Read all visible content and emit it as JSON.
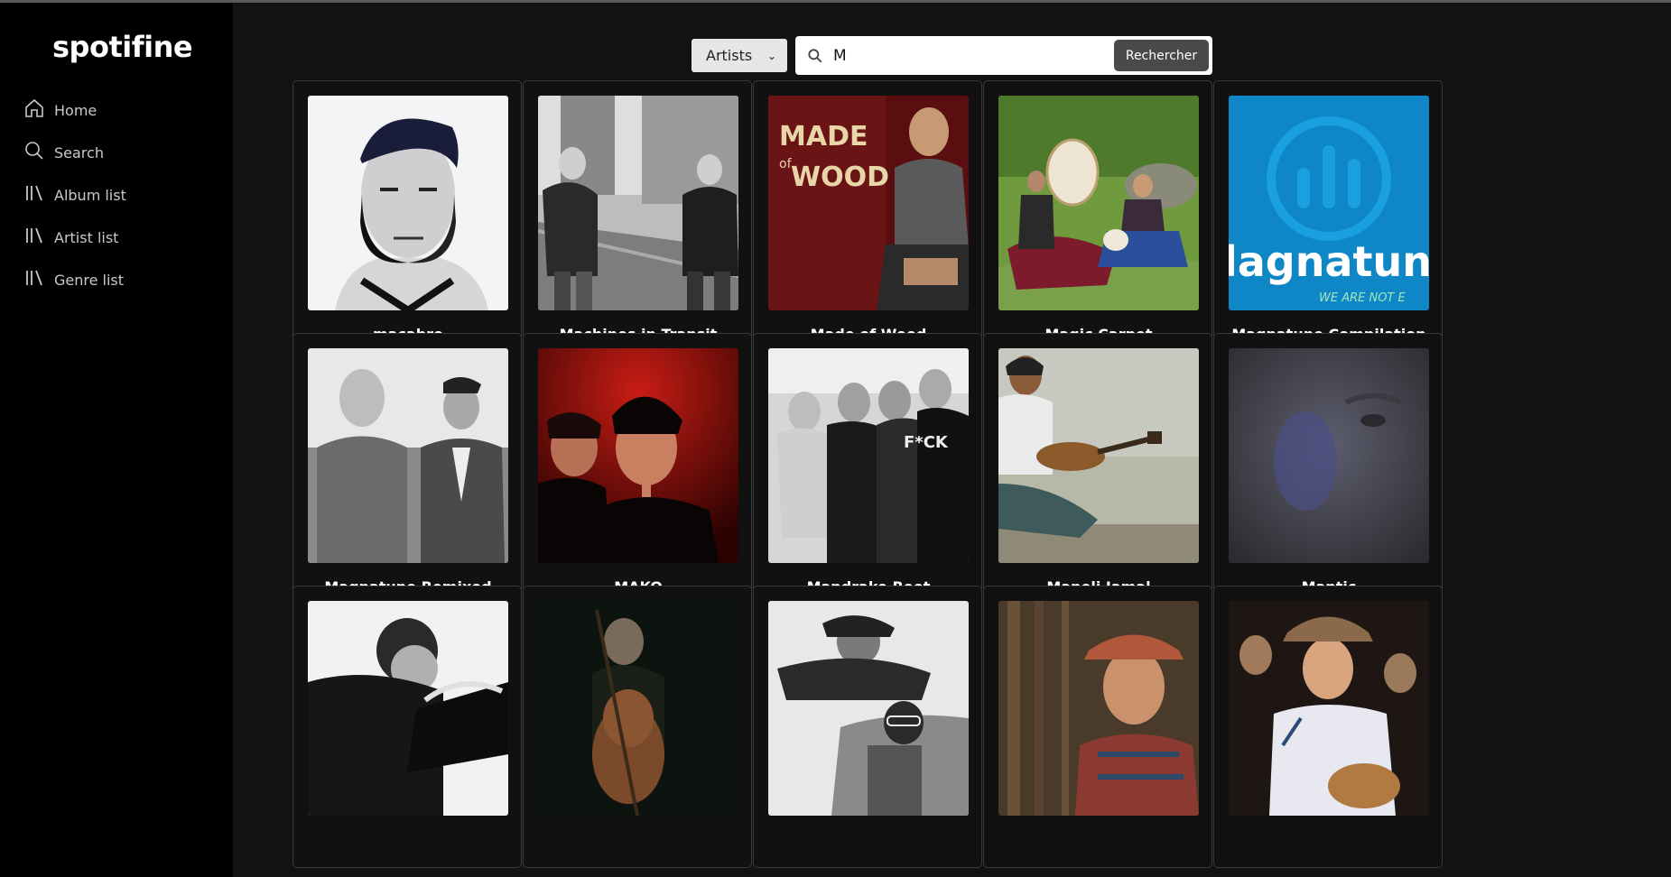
{
  "app": {
    "logo": "spotifine"
  },
  "sidebar": {
    "items": [
      {
        "label": "Home",
        "icon": "home-icon"
      },
      {
        "label": "Search",
        "icon": "search-icon"
      },
      {
        "label": "Album list",
        "icon": "library-icon"
      },
      {
        "label": "Artist list",
        "icon": "library-icon"
      },
      {
        "label": "Genre list",
        "icon": "library-icon"
      }
    ]
  },
  "search": {
    "category": "Artists",
    "query": "M",
    "button_label": "Rechercher"
  },
  "artists": [
    {
      "name": "macabro"
    },
    {
      "name": "Machines in Transit"
    },
    {
      "name": "Made of Wood"
    },
    {
      "name": "Magic Carpet"
    },
    {
      "name": "Magnatune Compilation",
      "art_text": "lagnatune",
      "art_sub": "WE ARE NOT E"
    },
    {
      "name": "Magnatune Remixed"
    },
    {
      "name": "MAKO"
    },
    {
      "name": "Mandrake Root"
    },
    {
      "name": "Maneli Jamal"
    },
    {
      "name": "Mantic"
    },
    {
      "name": ""
    },
    {
      "name": ""
    },
    {
      "name": ""
    },
    {
      "name": ""
    },
    {
      "name": ""
    }
  ],
  "colors": {
    "background": "#121212",
    "sidebar": "#000000",
    "accent_button": "#4a4a4a"
  }
}
